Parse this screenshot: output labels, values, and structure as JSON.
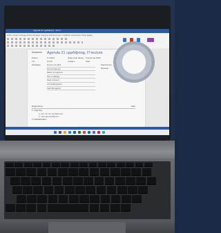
{
  "window": {
    "title": "Agenda 21 uppf&ouml;ljning - Word"
  },
  "ribbon": {
    "tabs": "Arkiv  Start  Infoga  Rita  Design  Layout  Referenser  Utskick  Granska  Visa  Hj&auml;lp"
  },
  "document": {
    "header_label": "Dokument",
    "title": "Agenda 21 uppföljning, IT-lecture",
    "meta": [
      {
        "label": "Datum",
        "value": "Fri 2023",
        "label2": "Diagnostik dialog",
        "value2": "Frontal del 2023"
      },
      {
        "label": "Tid",
        "value": "10:00",
        "label2": "Lokalen",
        "value2": "Stad"
      }
    ],
    "participants_label": "Deltagare",
    "participants": [
      "Emma von Bolt",
      "Nora Andersen",
      "Maria Jo Hamner",
      "Tom Lindberg",
      "Sara Larsson",
      "Jonna Bergqvist",
      "Felix Bergqvist"
    ],
    "side_notes": [
      "Sekreterare",
      "Beslutat"
    ],
    "agenda_label": "Dagordning",
    "agenda_right": "Start",
    "agenda_items": [
      {
        "num": "1.",
        "title": "Öppning"
      },
      {
        "num": "2.",
        "title": "Meddelanden"
      }
    ],
    "agenda_subitems": [
      "a.  Hur var din uppföljning?",
      "b.  Vad ska förbättras?"
    ]
  }
}
